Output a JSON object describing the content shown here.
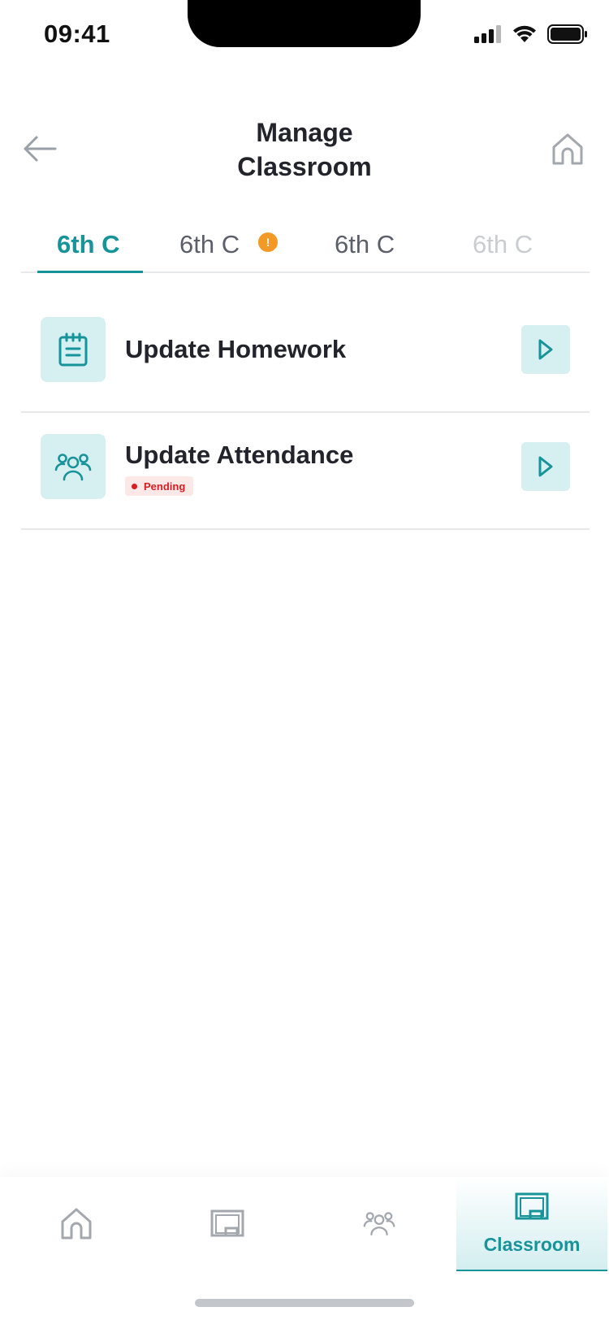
{
  "status_bar": {
    "time": "09:41"
  },
  "header": {
    "title_line1": "Manage",
    "title_line2": "Classroom"
  },
  "tabs": [
    {
      "label": "6th C",
      "active": true
    },
    {
      "label": "6th C",
      "alert": "!"
    },
    {
      "label": "6th C"
    },
    {
      "label": "6th C"
    }
  ],
  "actions": [
    {
      "label": "Update Homework",
      "icon": "homework-notebook-icon"
    },
    {
      "label": "Update Attendance",
      "icon": "attendance-people-icon",
      "badge": "Pending"
    }
  ],
  "bottom_nav": {
    "items": [
      {
        "icon": "home-icon"
      },
      {
        "icon": "board-icon"
      },
      {
        "icon": "people-icon"
      },
      {
        "icon": "classroom-icon",
        "label": "Classroom",
        "active": true
      }
    ]
  },
  "colors": {
    "accent": "#17939a",
    "accent_light": "#d6eff0",
    "alert": "#f39a26",
    "pending": "#d81e1e"
  }
}
